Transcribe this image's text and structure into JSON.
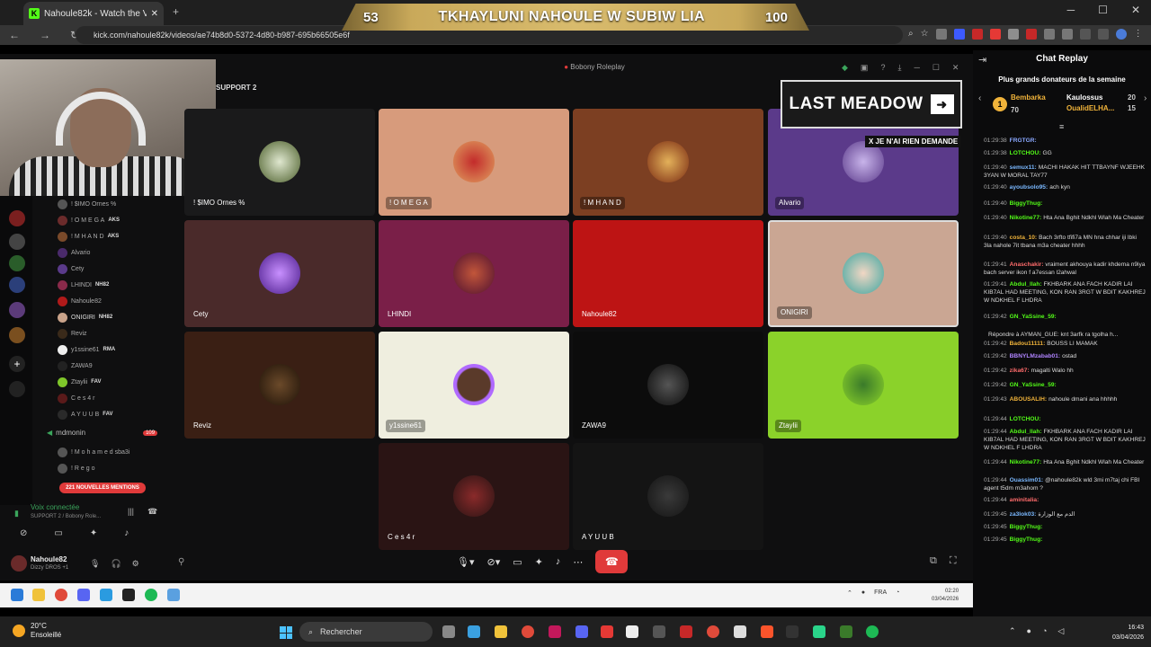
{
  "browser": {
    "tab_title": "Nahoule82k - Watch the VOD",
    "url": "kick.com/nahoule82k/videos/ae74b8d0-5372-4d80-b987-695b66505e6f",
    "overlay": {
      "left": "53",
      "title": "TKHAYLUNI NAHOULE W SUBIW LIA",
      "right": "100"
    }
  },
  "discord": {
    "window_title": "Bobony Roleplay",
    "voice_channel_header": "SUPPORT 2",
    "members": [
      {
        "name": "! $IMO Ornes %",
        "tag": ""
      },
      {
        "name": "! O M E G A",
        "tag": "AKS"
      },
      {
        "name": "! M H A N D",
        "tag": "AKS"
      },
      {
        "name": "Alvario",
        "tag": ""
      },
      {
        "name": "Cety",
        "tag": ""
      },
      {
        "name": "LHINDI",
        "tag": "NH82"
      },
      {
        "name": "Nahoule82",
        "tag": ""
      },
      {
        "name": "ONIGIRI",
        "tag": "NH82"
      },
      {
        "name": "Reviz",
        "tag": ""
      },
      {
        "name": "y1ssine61",
        "tag": "RMA"
      },
      {
        "name": "ZAWA9",
        "tag": ""
      },
      {
        "name": "Ztaylii",
        "tag": "FAV"
      },
      {
        "name": "C e s 4 r",
        "tag": ""
      },
      {
        "name": "A Y U U B",
        "tag": "FAV"
      }
    ],
    "second_channel": "mdmonin",
    "second_channel_badge": "109",
    "second_members": [
      "! M o h a m e d  sba3i",
      "! R e g o"
    ],
    "mentions_badge": "221 NOUVELLES MENTIONS",
    "voice_status": "Voix connectée",
    "voice_sub": "SUPPORT 2 / Bobony Role...",
    "user_name": "Nahoule82",
    "user_status": "Dizzy DROS +1",
    "tiles": [
      {
        "name": "! $IMO Ornes %"
      },
      {
        "name": "! O M E G A"
      },
      {
        "name": "! M H A N D"
      },
      {
        "name": "Alvario"
      },
      {
        "name": "Cety"
      },
      {
        "name": "LHINDI"
      },
      {
        "name": "Nahoule82"
      },
      {
        "name": "ONIGIRI"
      },
      {
        "name": "Reviz"
      },
      {
        "name": "y1ssine61"
      },
      {
        "name": "ZAWA9"
      },
      {
        "name": "Ztaylii"
      },
      {
        "name": "C e s 4 r"
      },
      {
        "name": "A Y U U B"
      }
    ],
    "promo_title": "LAST MEADOW",
    "promo_sub": "X JE N'AI RIEN DEMANDE"
  },
  "inner_taskbar": {
    "lang": "FRA",
    "time": "02:20",
    "date": "03/04/2026"
  },
  "chat": {
    "title": "Chat Replay",
    "donors_header": "Plus grands donateurs de la semaine",
    "rank": "1",
    "donors": [
      {
        "name": "Bembarka",
        "amount": "70"
      },
      {
        "name": "Kaulossus",
        "amount": "20"
      },
      {
        "name": "OualidELHA...",
        "amount": "15"
      }
    ],
    "messages": [
      {
        "time": "01:29:38",
        "user": "FRGTGR:",
        "text": "",
        "color": "#8aa8ff"
      },
      {
        "time": "01:29:38",
        "user": "LOTCHOU:",
        "text": "GG",
        "color": "#53fc18"
      },
      {
        "time": "01:29:40",
        "user": "semux11:",
        "text": "MACHI HAKAK HIT TTBAYNF WJEEHK 3YAN W MORAL TAY77",
        "color": "#7ab8ff"
      },
      {
        "time": "01:29:40",
        "user": "ayoubsolo95:",
        "text": "ach kyn",
        "color": "#7ab8ff"
      },
      {
        "time": "01:29:40",
        "user": "BiggyThug:",
        "text": "",
        "color": "#53fc18"
      },
      {
        "time": "01:29:40",
        "user": "Nikotine77:",
        "text": "Hta Ana Bghit Ndkhl Wlah Ma Cheater",
        "color": "#53fc18"
      },
      {
        "time": "01:29:40",
        "user": "costa_10:",
        "text": "Bach 3rfto tfifi7a MN hna chhar iji lbki 3la nahole 7it tbana m3a cheater hhhh",
        "color": "#f0b33a"
      },
      {
        "time": "01:29:41",
        "user": "Anaschakir:",
        "text": "vraiment akhouya kadir khdema n9iya bach server ikon f a7essan l2ahwal",
        "color": "#ff6b6b"
      },
      {
        "time": "01:29:41",
        "user": "Abdul_llah:",
        "text": "FKHBARK ANA FACH KADIR LAI KIB7AL HAD MEETING, KON RAN 3RGT W BDIT KAKHREJ W NDKHEL F LHDRA",
        "color": "#53fc18"
      },
      {
        "time": "01:29:42",
        "user": "GN_YaSsine_59:",
        "text": "",
        "color": "#53fc18"
      },
      {
        "time": "",
        "user": "",
        "text": "Répondre à AYMAN_GUE: knt 3arfk ra tgolha h...",
        "color": "#888"
      },
      {
        "time": "01:29:42",
        "user": "Badou11111:",
        "text": "BOUSS LI MAMAK",
        "color": "#f0b33a"
      },
      {
        "time": "01:29:42",
        "user": "BBNYLMzabab01:",
        "text": "ostad",
        "color": "#b084ff"
      },
      {
        "time": "01:29:42",
        "user": "zika67:",
        "text": "magalti Walo hh",
        "color": "#ff6b6b"
      },
      {
        "time": "01:29:42",
        "user": "GN_YaSsine_59:",
        "text": "",
        "color": "#53fc18"
      },
      {
        "time": "01:29:43",
        "user": "ABOUSALIH:",
        "text": "nahoule dmani ana hhhhh",
        "color": "#f0b33a"
      },
      {
        "time": "01:29:44",
        "user": "LOTCHOU:",
        "text": "",
        "color": "#53fc18"
      },
      {
        "time": "01:29:44",
        "user": "Abdul_llah:",
        "text": "FKHBARK ANA FACH KADIR LAI KIB7AL HAD MEETING, KON RAN 3RGT W BDIT KAKHREJ W NDKHEL F LHDRA",
        "color": "#53fc18"
      },
      {
        "time": "01:29:44",
        "user": "Nikotine77:",
        "text": "Hta Ana Bghit Ndkhl Wlah Ma Cheater",
        "color": "#53fc18"
      },
      {
        "time": "01:29:44",
        "user": "Ouassim01:",
        "text": "@nahoule82k wld 3mi m7taj chi FBI agent t5dm m3ahom ?",
        "color": "#7ab8ff"
      },
      {
        "time": "01:29:44",
        "user": "aminitalia:",
        "text": "",
        "color": "#ff6b6b"
      },
      {
        "time": "01:29:45",
        "user": "za3lok03:",
        "text": "الدم مع الوزارة",
        "color": "#7ab8ff"
      },
      {
        "time": "01:29:45",
        "user": "BiggyThug:",
        "text": "",
        "color": "#53fc18"
      },
      {
        "time": "01:29:45",
        "user": "BiggyThug:",
        "text": "",
        "color": "#53fc18"
      }
    ]
  },
  "taskbar": {
    "temp": "20°C",
    "weather": "Ensoleillé",
    "search_placeholder": "Rechercher",
    "time": "16:43",
    "date": "03/04/2026"
  }
}
